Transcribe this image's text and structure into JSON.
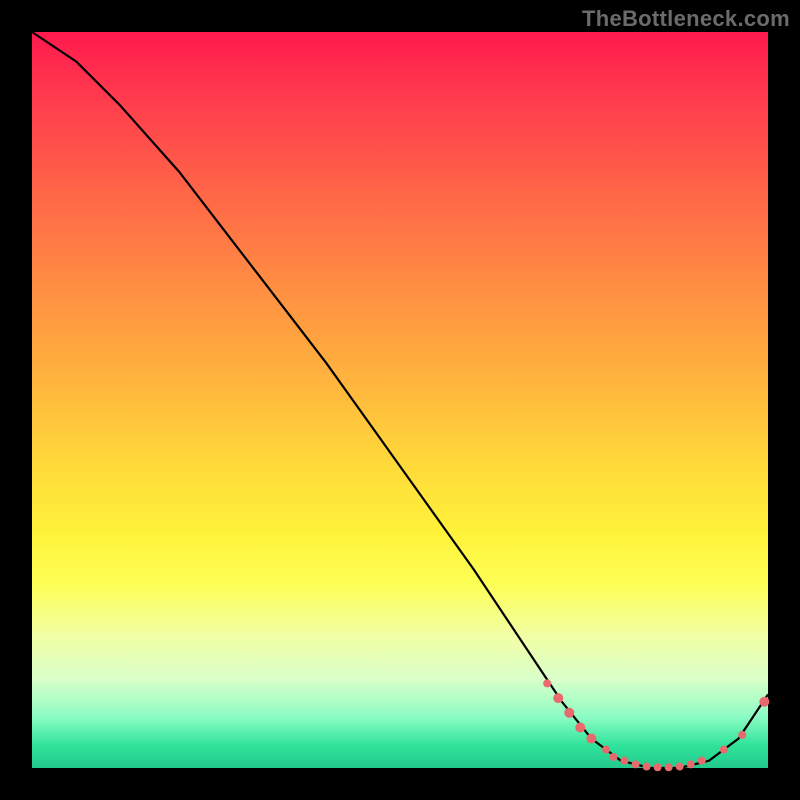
{
  "attribution": "TheBottleneck.com",
  "chart_data": {
    "type": "line",
    "title": "",
    "xlabel": "",
    "ylabel": "",
    "xlim": [
      0,
      100
    ],
    "ylim": [
      0,
      100
    ],
    "series": [
      {
        "name": "curve",
        "x": [
          0,
          6,
          12,
          20,
          30,
          40,
          50,
          60,
          68,
          72,
          76,
          80,
          84,
          88,
          92,
          96,
          100
        ],
        "y": [
          100,
          96,
          90,
          81,
          68,
          55,
          41,
          27,
          15,
          9,
          4,
          1,
          0,
          0,
          1,
          4,
          10
        ]
      }
    ],
    "markers": [
      {
        "x": 70.0,
        "y": 11.5,
        "r": 4
      },
      {
        "x": 71.5,
        "y": 9.5,
        "r": 5
      },
      {
        "x": 73.0,
        "y": 7.5,
        "r": 5
      },
      {
        "x": 74.5,
        "y": 5.5,
        "r": 5
      },
      {
        "x": 76.0,
        "y": 4.0,
        "r": 5
      },
      {
        "x": 78.0,
        "y": 2.5,
        "r": 4
      },
      {
        "x": 79.0,
        "y": 1.5,
        "r": 4
      },
      {
        "x": 80.5,
        "y": 1.0,
        "r": 4
      },
      {
        "x": 82.0,
        "y": 0.5,
        "r": 4
      },
      {
        "x": 83.5,
        "y": 0.2,
        "r": 4
      },
      {
        "x": 85.0,
        "y": 0.1,
        "r": 4
      },
      {
        "x": 86.5,
        "y": 0.1,
        "r": 4
      },
      {
        "x": 88.0,
        "y": 0.2,
        "r": 4
      },
      {
        "x": 89.5,
        "y": 0.5,
        "r": 4
      },
      {
        "x": 91.0,
        "y": 1.0,
        "r": 4
      },
      {
        "x": 94.0,
        "y": 2.5,
        "r": 4
      },
      {
        "x": 96.5,
        "y": 4.5,
        "r": 4
      },
      {
        "x": 99.5,
        "y": 9.0,
        "r": 5
      }
    ],
    "colors": {
      "line": "#000000",
      "marker": "#e86a6d"
    }
  }
}
